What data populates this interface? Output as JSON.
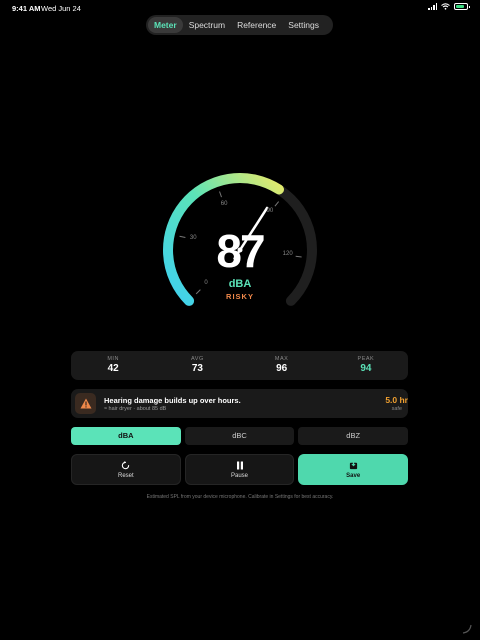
{
  "status_bar": {
    "time": "9:41 AM",
    "date": "Wed Jun 24"
  },
  "tabs": [
    {
      "label": "Meter",
      "active": true
    },
    {
      "label": "Spectrum",
      "active": false
    },
    {
      "label": "Reference",
      "active": false
    },
    {
      "label": "Settings",
      "active": false
    }
  ],
  "gauge": {
    "value": "87",
    "unit": "dBA",
    "status": "RISKY",
    "needle_level_db": 87,
    "scale_max_db": 140,
    "tick_labels": [
      "0",
      "30",
      "60",
      "90",
      "120"
    ],
    "colors": {
      "low": "#3fd0f0",
      "mid": "#5be3b8",
      "high": "#e7ea6a",
      "status": "#f0884a"
    }
  },
  "stats": [
    {
      "label": "MIN",
      "value": "42"
    },
    {
      "label": "AVG",
      "value": "73"
    },
    {
      "label": "MAX",
      "value": "96"
    },
    {
      "label": "PEAK",
      "value": "94",
      "color": "#5be3b8"
    }
  ],
  "warning": {
    "title": "Hearing damage builds up over hours.",
    "subtitle": "≈ hair dryer · about 85 dB",
    "safe_time": "5.0 hr",
    "safe_label": "safe",
    "icon": "warning-triangle-icon"
  },
  "weightings": [
    {
      "label": "dBA",
      "active": true
    },
    {
      "label": "dBC",
      "active": false
    },
    {
      "label": "dBZ",
      "active": false
    }
  ],
  "actions": [
    {
      "label": "Reset",
      "icon": "reset-icon"
    },
    {
      "label": "Pause",
      "icon": "pause-icon"
    },
    {
      "label": "Save",
      "icon": "save-icon",
      "primary": true
    }
  ],
  "footnote": "Estimated SPL from your device microphone. Calibrate in Settings for best accuracy."
}
